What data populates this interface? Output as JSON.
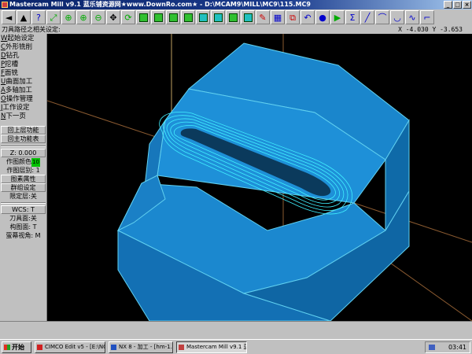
{
  "window": {
    "title": "Mastercam Mill v9.1 蓝乐铺资源网★www.DownRo.com★ - D:\\MCAM9\\MILL\\MC9\\115.MC9",
    "controls": [
      "_",
      "□",
      "×"
    ]
  },
  "toolbar": {
    "icons": [
      "back-arrow-icon",
      "up-arrow-icon",
      "help-icon",
      "zoom-fit-icon",
      "zoom-window-icon",
      "zoom-in-icon",
      "zoom-out-icon",
      "pan-icon",
      "repaint-icon",
      "view-top-icon",
      "view-front-icon",
      "view-side-icon",
      "view-iso-icon",
      "view-cube-icon",
      "shade-icon",
      "cplane-icon",
      "tplane-icon",
      "color-icon",
      "level-icon",
      "group-icon",
      "undo-icon",
      "sphere-icon",
      "play-icon",
      "analyze-icon",
      "line-icon",
      "arc-icon",
      "fillet-icon",
      "spline-icon",
      "trim-icon"
    ]
  },
  "status": {
    "prompt": "刀具路径之相关设定:",
    "coords": "X -4.030  Y -3.653"
  },
  "menu": {
    "items": [
      {
        "key": "W",
        "label": "起始设定"
      },
      {
        "key": "C",
        "label": "外形铣削"
      },
      {
        "key": "D",
        "label": "钻孔"
      },
      {
        "key": "P",
        "label": "挖槽"
      },
      {
        "key": "F",
        "label": "面铣"
      },
      {
        "key": "U",
        "label": "曲面加工"
      },
      {
        "key": "A",
        "label": "多轴加工"
      },
      {
        "key": "O",
        "label": "操作管理"
      },
      {
        "key": "J",
        "label": "工作设定"
      },
      {
        "key": "N",
        "label": "下一页"
      }
    ],
    "back": "回上层功能",
    "main": "回主功能表",
    "z": "Z:  0.000",
    "color_label": "作图颜色",
    "color_value": "10",
    "layer": "作图层别: 1",
    "attributes": "图素属性",
    "group": "群组设定",
    "limit_layer": "限定层:关",
    "wcs": "WCS:  T",
    "tplane": "刀具面:关",
    "cplane": "构图面: T",
    "screen_view": "萤幕视角: M"
  },
  "taskbar": {
    "start": "开始",
    "tasks": [
      "CIMCO Edit v5 - [E:\\NC\\...",
      "NX 8 - 加工 - [hm-1.prt]",
      "Mastercam Mill v9.1 蓝..."
    ],
    "time": "03:41"
  },
  "colors": {
    "viewport_bg": "#000000",
    "part_face": "#1e90d8",
    "part_face_dark": "#1070b0",
    "part_edge": "#70e0ff",
    "toolpath": "#40f0ff",
    "axis_line": "#c08040"
  }
}
